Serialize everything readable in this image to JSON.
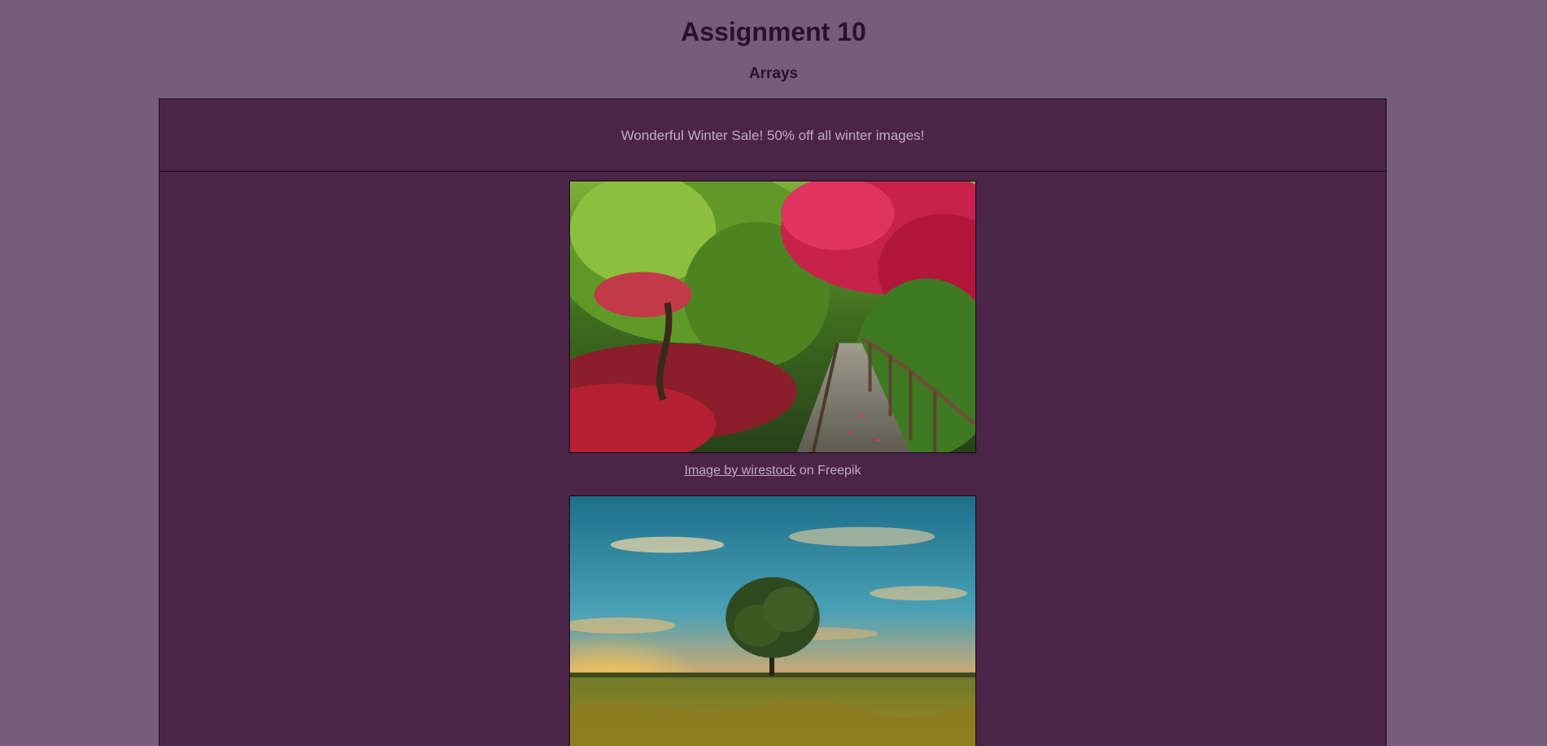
{
  "header": {
    "title": "Assignment 10",
    "subtitle": "Arrays"
  },
  "banner": {
    "text": "Wonderful Winter Sale! 50% off all winter images!"
  },
  "images": [
    {
      "subject": "garden-path",
      "credit_link": "Image by wirestock",
      "credit_suffix": " on Freepik"
    },
    {
      "subject": "tree-at-sunset"
    }
  ],
  "colors": {
    "page_bg": "#765e7a",
    "panel_bg": "#4a2549",
    "title_text": "#2d0f33",
    "muted_text": "#c2aac2"
  }
}
